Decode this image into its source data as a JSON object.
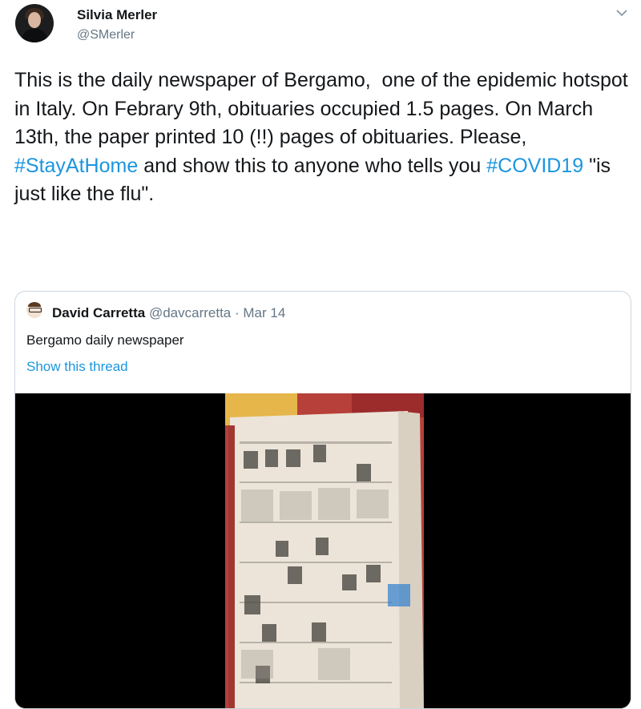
{
  "author": {
    "name": "Silvia Merler",
    "handle": "@SMerler"
  },
  "tweet": {
    "text_before_tag1": "This is the daily newspaper of Bergamo,  one of the epidemic hotspot in Italy. On Febrary 9th, obituaries occupied 1.5 pages. On March 13th, the paper printed 10 (!!) pages of obituaries. Please, ",
    "hashtag1": "#StayAtHome",
    "text_mid": " and show this to anyone who tells you ",
    "hashtag2": "#COVID19",
    "text_end": " \"is just like the flu\"."
  },
  "quoted": {
    "name": "David Carretta",
    "handle": "@davcarretta",
    "separator": " · ",
    "date": "Mar 14",
    "text": "Bergamo daily newspaper",
    "thread_link": "Show this thread"
  },
  "icons": {
    "menu": "chevron-down-icon"
  },
  "colors": {
    "link": "#1b95e0",
    "muted": "#657786",
    "border": "#ccd6dd"
  }
}
